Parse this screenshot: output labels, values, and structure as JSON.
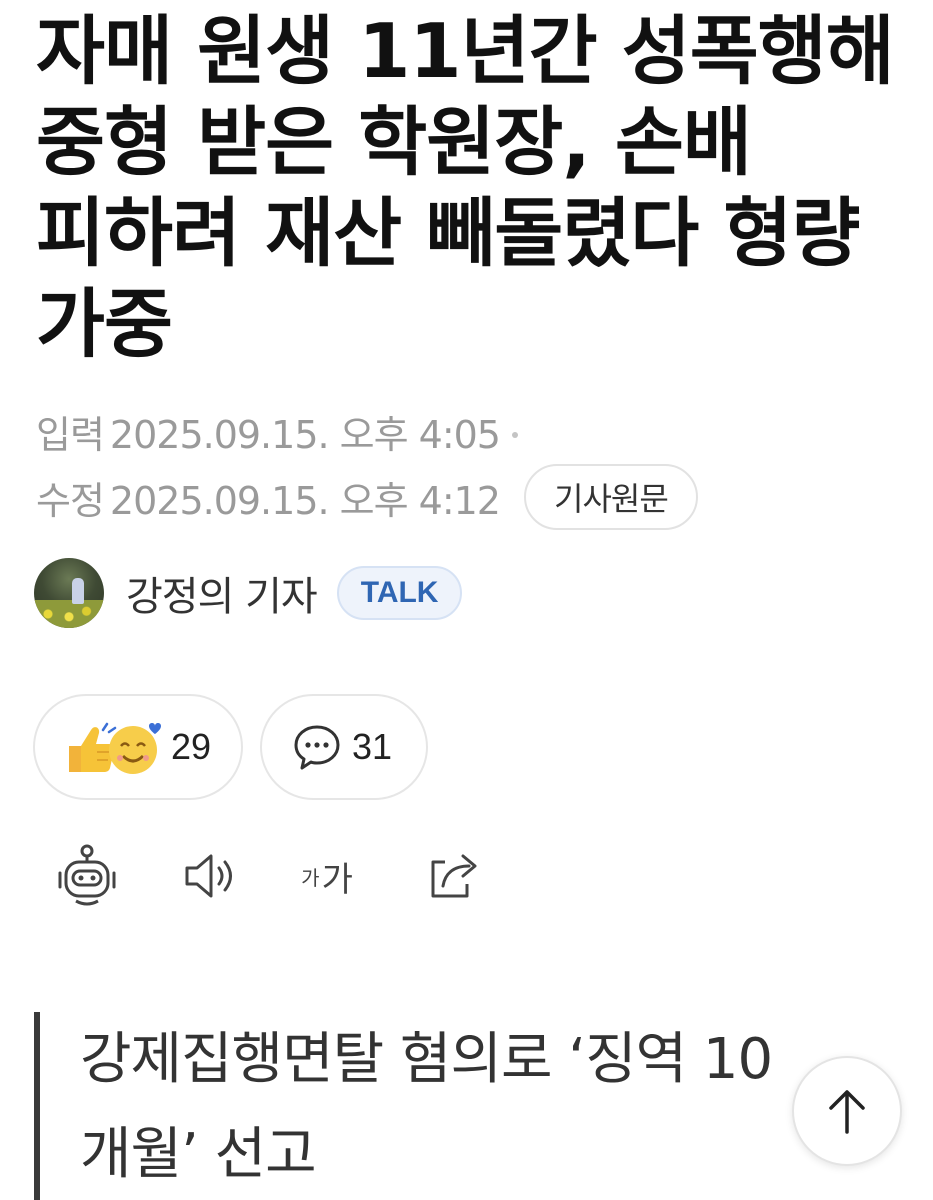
{
  "headline": "자매 원생 11년간 성폭행해 중형 받은 학원장, 손배 피하려 재산 빼돌렸다 형량 가중",
  "meta": {
    "input_label": "입력",
    "input_value": "2025.09.15. 오후 4:05",
    "edit_label": "수정",
    "edit_value": "2025.09.15. 오후 4:12",
    "original_button": "기사원문"
  },
  "reporter": {
    "name": "강정의 기자",
    "talk_label": "TALK"
  },
  "reactions": {
    "reaction_count": "29",
    "comment_count": "31"
  },
  "toolbar": {
    "icons": [
      "robot-summary-icon",
      "speaker-icon",
      "font-size-icon",
      "share-icon"
    ],
    "font_small": "가",
    "font_large": "가"
  },
  "subhead": "강제집행면탈 혐의로 ‘징역 10개월’ 선고",
  "colors": {
    "talk_blue": "#2f66b3",
    "meta_gray": "#9a9a9a",
    "emoji_yellow": "#f6c338"
  }
}
